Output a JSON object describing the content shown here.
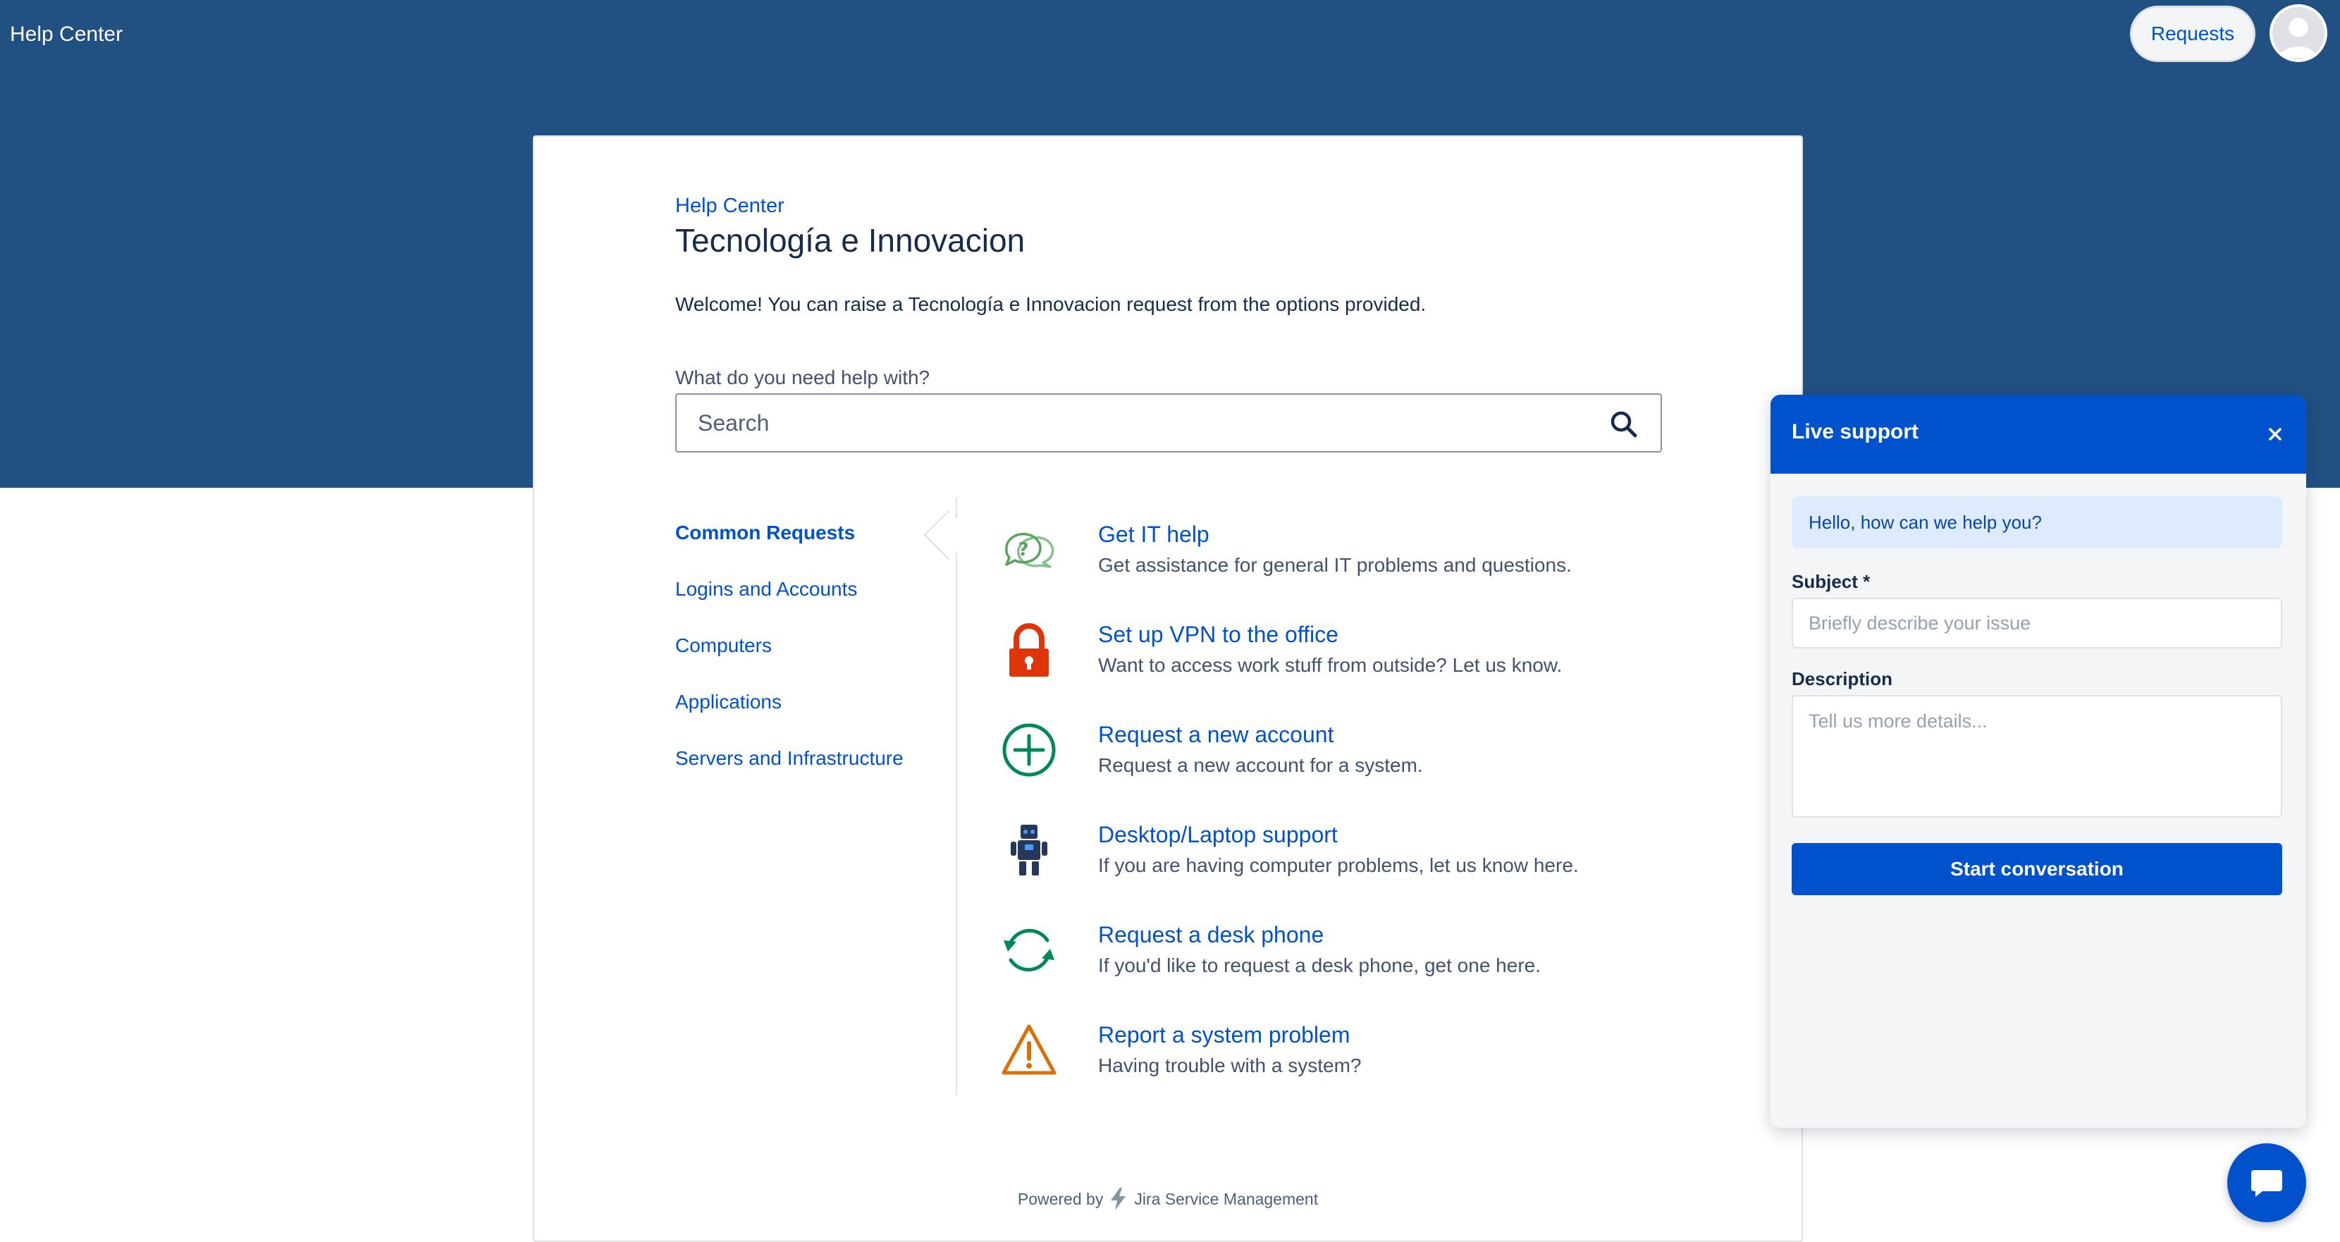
{
  "topbar": {
    "title": "Help Center",
    "requests_label": "Requests"
  },
  "main": {
    "breadcrumb": "Help Center",
    "title": "Tecnología e Innovacion",
    "welcome": "Welcome! You can raise a Tecnología e Innovacion request from the options provided.",
    "search_label": "What do you need help with?",
    "search_placeholder": "Search"
  },
  "categories": [
    {
      "label": "Common Requests",
      "active": true
    },
    {
      "label": "Logins and Accounts",
      "active": false
    },
    {
      "label": "Computers",
      "active": false
    },
    {
      "label": "Applications",
      "active": false
    },
    {
      "label": "Servers and Infrastructure",
      "active": false
    }
  ],
  "request_types": [
    {
      "title": "Get IT help",
      "description": "Get assistance for general IT problems and questions.",
      "icon": "question-bubbles-icon"
    },
    {
      "title": "Set up VPN to the office",
      "description": "Want to access work stuff from outside? Let us know.",
      "icon": "padlock-icon"
    },
    {
      "title": "Request a new account",
      "description": "Request a new account for a system.",
      "icon": "plus-circle-icon"
    },
    {
      "title": "Desktop/Laptop support",
      "description": "If you are having computer problems, let us know here.",
      "icon": "robot-icon"
    },
    {
      "title": "Request a desk phone",
      "description": "If you'd like to request a desk phone, get one here.",
      "icon": "refresh-arrows-icon"
    },
    {
      "title": "Report a system problem",
      "description": "Having trouble with a system?",
      "icon": "warning-triangle-icon"
    }
  ],
  "footer": {
    "powered_by": "Powered by",
    "product": "Jira Service Management"
  },
  "chat": {
    "title": "Live support",
    "greeting": "Hello, how can we help you?",
    "subject_label": "Subject *",
    "subject_placeholder": "Briefly describe your issue",
    "description_label": "Description",
    "description_placeholder": "Tell us more details...",
    "start_label": "Start conversation"
  },
  "colors": {
    "banner": "#215082",
    "link": "#0052cc",
    "primary_button": "#0052cc",
    "chat_bubble": "#deebff",
    "icon_teal": "#57a55a",
    "icon_red": "#de350b",
    "icon_green": "#00875a",
    "icon_navy": "#172b4d",
    "icon_orange": "#d97008"
  }
}
